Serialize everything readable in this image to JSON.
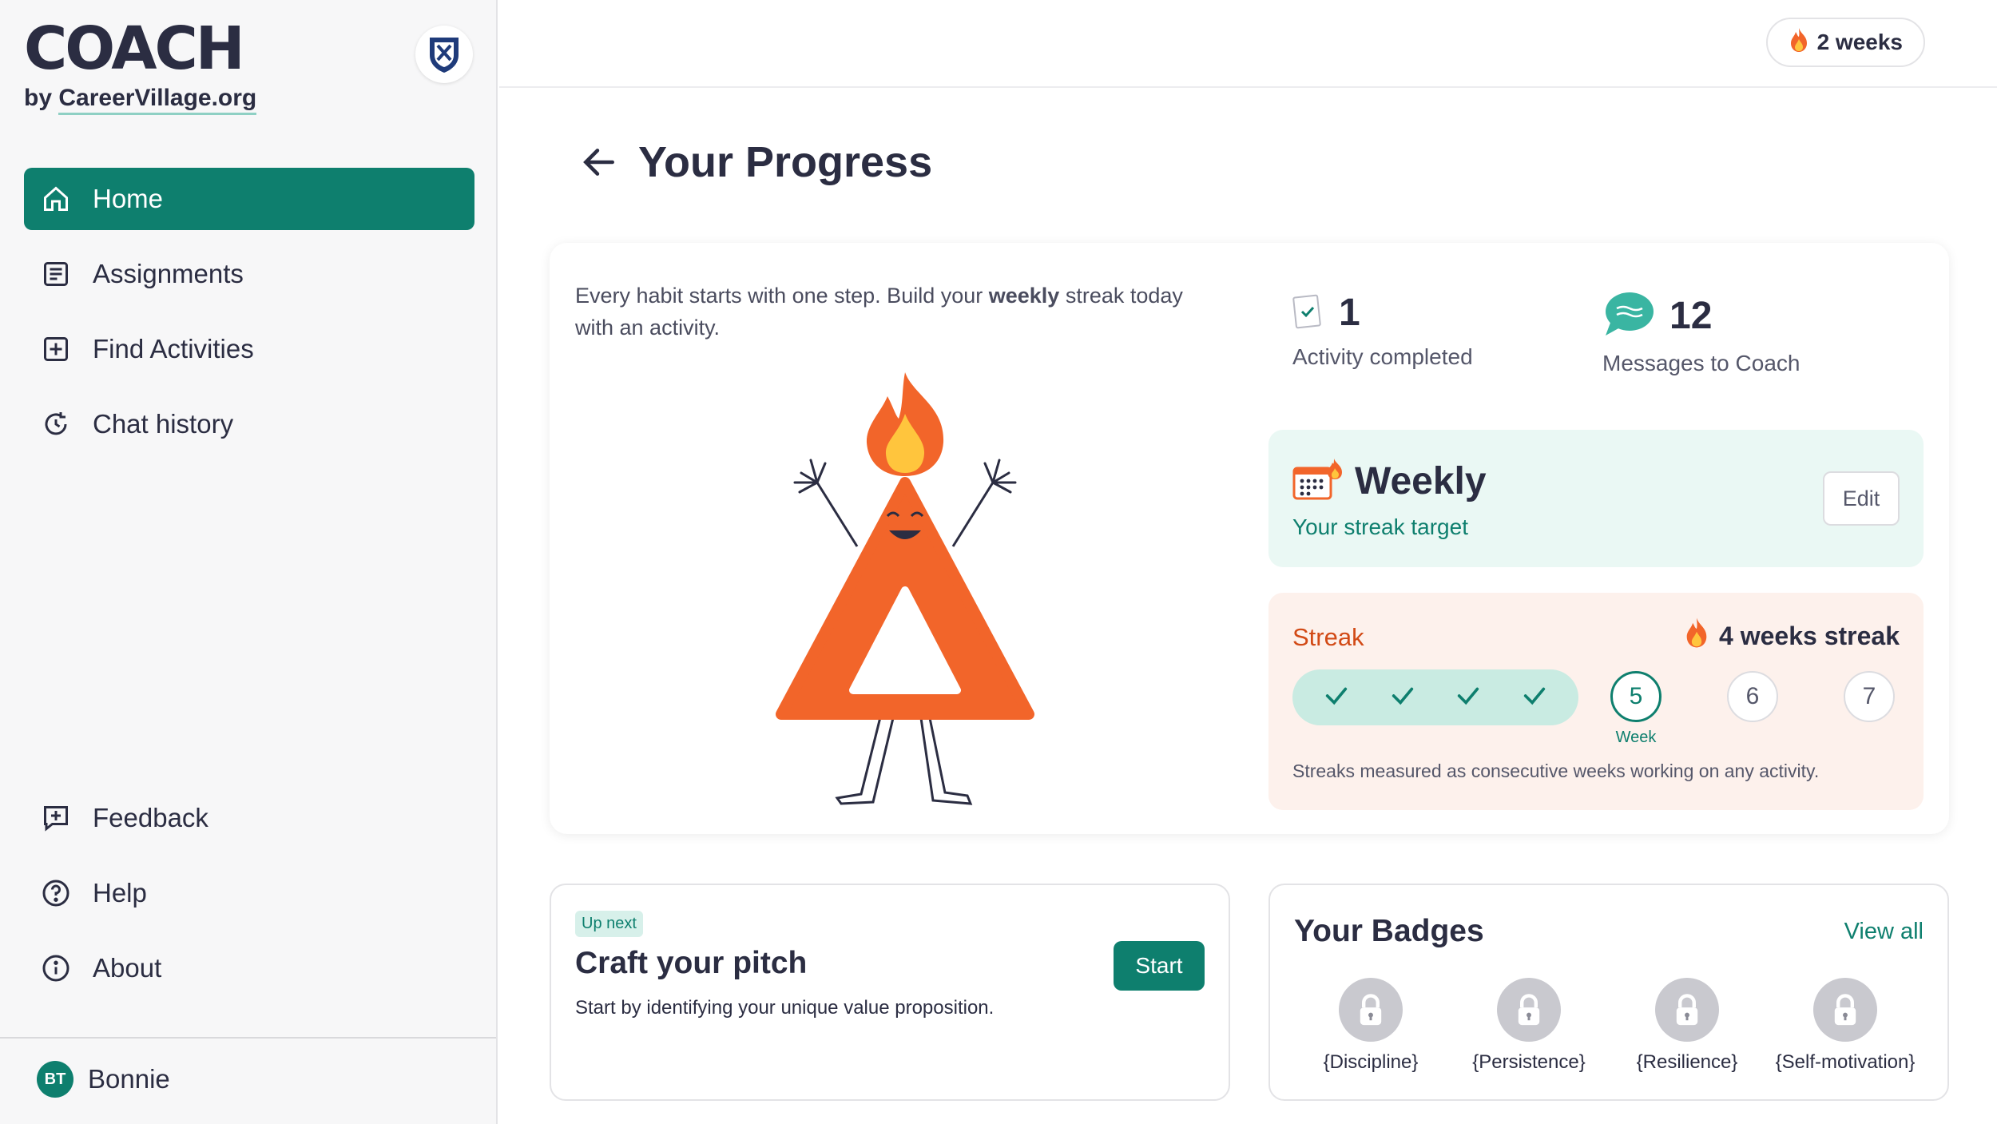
{
  "brand": {
    "logo": "COACH",
    "by": "by",
    "org": "CareerVillage.org"
  },
  "sidebar": {
    "items": [
      {
        "label": "Home",
        "icon": "home-icon",
        "active": true
      },
      {
        "label": "Assignments",
        "icon": "document-icon"
      },
      {
        "label": "Find Activities",
        "icon": "plus-square-icon"
      },
      {
        "label": "Chat history",
        "icon": "history-icon"
      }
    ],
    "bottom_items": [
      {
        "label": "Feedback",
        "icon": "feedback-icon"
      },
      {
        "label": "Help",
        "icon": "help-icon"
      },
      {
        "label": "About",
        "icon": "info-icon"
      }
    ],
    "user": {
      "initials": "BT",
      "name": "Bonnie"
    }
  },
  "topbar": {
    "streak": "2 weeks",
    "streak_icon": "flame-icon"
  },
  "page": {
    "title": "Your Progress"
  },
  "progress": {
    "intro_before": "Every habit starts with one step. Build your ",
    "intro_bold": "weekly",
    "intro_after": " streak today with an activity.",
    "activities_count": "1",
    "activities_label": "Activity completed",
    "messages_count": "12",
    "messages_label": "Messages to Coach"
  },
  "target": {
    "title": "Weekly",
    "subtitle": "Your streak target",
    "edit_label": "Edit"
  },
  "streak": {
    "label": "Streak",
    "count": "4 weeks streak",
    "completed_weeks": 4,
    "weeks": [
      "5",
      "6",
      "7"
    ],
    "current_caption": "Week",
    "note": "Streaks measured as consecutive weeks working on any activity."
  },
  "up_next": {
    "tag": "Up next",
    "title": "Craft your pitch",
    "description": "Start by identifying your unique value proposition.",
    "start_label": "Start"
  },
  "badges": {
    "title": "Your Badges",
    "view_all": "View all",
    "items": [
      "{Discipline}",
      "{Persistence}",
      "{Resilience}",
      "{Self-motivation}"
    ]
  },
  "colors": {
    "accent": "#0e7f6e",
    "streak_orange": "#d24a16",
    "mascot": "#f2652a"
  }
}
